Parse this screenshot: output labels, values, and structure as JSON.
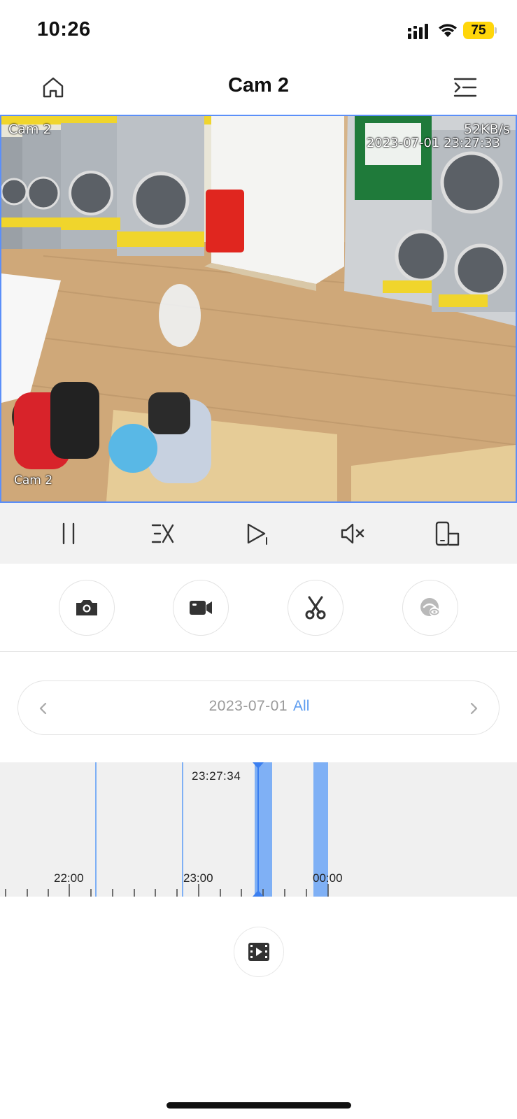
{
  "status": {
    "time": "10:26",
    "battery": "75"
  },
  "nav": {
    "title": "Cam 2"
  },
  "video": {
    "osd_camera_top": "Cam 2",
    "osd_bitrate": "52KB/s",
    "osd_timestamp": "2023-07-01 23:27:33",
    "osd_camera_bottom": "Cam 2"
  },
  "date_selector": {
    "date": "2023-07-01",
    "filter": "All"
  },
  "timeline": {
    "cursor_time": "23:27:34",
    "labels": [
      "22:00",
      "23:00",
      "00:00"
    ]
  },
  "colors": {
    "accent": "#5b9bf0",
    "timeline_bg": "#f0f0f0",
    "recording": "#7fb0f5",
    "battery": "#ffd60a"
  },
  "icons": {
    "home": "home-icon",
    "menu": "menu-collapse-icon",
    "pause": "pause-icon",
    "speed": "speed-1x-icon",
    "frame": "play-step-icon",
    "mute": "speaker-mute-icon",
    "rotate": "landscape-icon",
    "snapshot": "camera-icon",
    "record": "video-icon",
    "clip": "scissors-icon",
    "privacy": "eye-mask-icon",
    "clips_list": "film-icon"
  }
}
